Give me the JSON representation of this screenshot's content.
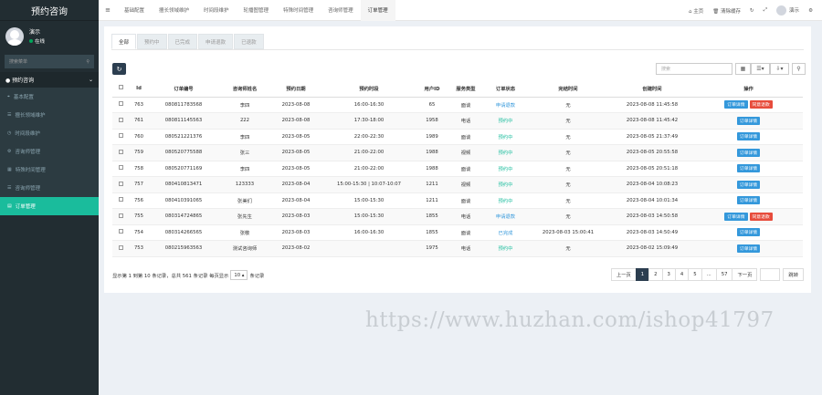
{
  "sidebar": {
    "brand": "预约咨询",
    "user_name": "演示",
    "user_status": "在线",
    "search_placeholder": "搜索菜单",
    "menu_header": "预约咨询",
    "items": [
      {
        "label": "基本配置",
        "icon": "location-icon"
      },
      {
        "label": "擅长领域维护",
        "icon": "list-icon"
      },
      {
        "label": "时间段维护",
        "icon": "clock-icon"
      },
      {
        "label": "咨询师管理",
        "icon": "gear-icon"
      },
      {
        "label": "特殊时间管理",
        "icon": "calendar-icon"
      },
      {
        "label": "咨询师管理",
        "icon": "list-icon"
      },
      {
        "label": "订单管理",
        "icon": "file-icon"
      }
    ]
  },
  "topbar": {
    "tabs": [
      "基础配置",
      "擅长领域维护",
      "时间段维护",
      "轮播图管理",
      "特殊时间管理",
      "咨询师管理",
      "订单管理"
    ],
    "home": "主页",
    "clear_cache": "清除缓存",
    "user": "演示"
  },
  "subtabs": [
    "全部",
    "预约中",
    "已完成",
    "申请退款",
    "已退款"
  ],
  "toolbar": {
    "search_placeholder": "搜索"
  },
  "table": {
    "headers": [
      "Id",
      "订单编号",
      "咨询师姓名",
      "预约日期",
      "预约时段",
      "用户ID",
      "服务类型",
      "订单状态",
      "完结时间",
      "创建时间",
      "操作"
    ],
    "rows": [
      {
        "id": "763",
        "order": "080811783568",
        "counselor": "李四",
        "date": "2023-08-08",
        "slot": "16:00-16:30",
        "uid": "65",
        "service": "面谈",
        "status": "申请退款",
        "status_class": "st-blue",
        "finish": "无",
        "created": "2023-08-08 11:45:58",
        "actions": [
          "订单详情",
          "同意退款"
        ]
      },
      {
        "id": "761",
        "order": "080811145563",
        "counselor": "222",
        "date": "2023-08-08",
        "slot": "17:30-18:00",
        "uid": "1958",
        "service": "电话",
        "status": "预约中",
        "status_class": "st-green",
        "finish": "无",
        "created": "2023-08-08 11:45:42",
        "actions": [
          "订单详情"
        ]
      },
      {
        "id": "760",
        "order": "080521221376",
        "counselor": "李四",
        "date": "2023-08-05",
        "slot": "22:00-22:30",
        "uid": "1989",
        "service": "面谈",
        "status": "预约中",
        "status_class": "st-green",
        "finish": "无",
        "created": "2023-08-05 21:37:49",
        "actions": [
          "订单详情"
        ]
      },
      {
        "id": "759",
        "order": "080520775588",
        "counselor": "张三",
        "date": "2023-08-05",
        "slot": "21:00-22:00",
        "uid": "1988",
        "service": "视频",
        "status": "预约中",
        "status_class": "st-green",
        "finish": "无",
        "created": "2023-08-05 20:55:58",
        "actions": [
          "订单详情"
        ]
      },
      {
        "id": "758",
        "order": "080520771169",
        "counselor": "李四",
        "date": "2023-08-05",
        "slot": "21:00-22:00",
        "uid": "1988",
        "service": "面谈",
        "status": "预约中",
        "status_class": "st-green",
        "finish": "无",
        "created": "2023-08-05 20:51:18",
        "actions": [
          "订单详情"
        ]
      },
      {
        "id": "757",
        "order": "080410813471",
        "counselor": "123333",
        "date": "2023-08-04",
        "slot": "15:00-15:30 | 10:07-10:07",
        "uid": "1211",
        "service": "视频",
        "status": "预约中",
        "status_class": "st-green",
        "finish": "无",
        "created": "2023-08-04 10:08:23",
        "actions": [
          "订单详情"
        ]
      },
      {
        "id": "756",
        "order": "080410391065",
        "counselor": "张美们",
        "date": "2023-08-04",
        "slot": "15:00-15:30",
        "uid": "1211",
        "service": "面谈",
        "status": "预约中",
        "status_class": "st-green",
        "finish": "无",
        "created": "2023-08-04 10:01:34",
        "actions": [
          "订单详情"
        ]
      },
      {
        "id": "755",
        "order": "080314724865",
        "counselor": "张先生",
        "date": "2023-08-03",
        "slot": "15:00-15:30",
        "uid": "1855",
        "service": "电话",
        "status": "申请退款",
        "status_class": "st-blue",
        "finish": "无",
        "created": "2023-08-03 14:50:58",
        "actions": [
          "订单详情",
          "同意退款"
        ]
      },
      {
        "id": "754",
        "order": "080314266565",
        "counselor": "张敬",
        "date": "2023-08-03",
        "slot": "16:00-16:30",
        "uid": "1855",
        "service": "面谈",
        "status": "已完成",
        "status_class": "st-blue",
        "finish": "2023-08-03 15:00:41",
        "created": "2023-08-03 14:50:49",
        "actions": [
          "订单详情"
        ]
      },
      {
        "id": "753",
        "order": "080215963563",
        "counselor": "测试咨询师",
        "date": "2023-08-02",
        "slot": "",
        "uid": "1975",
        "service": "电话",
        "status": "预约中",
        "status_class": "st-green",
        "finish": "无",
        "created": "2023-08-02 15:09:49",
        "actions": [
          "订单详情"
        ]
      }
    ]
  },
  "footer": {
    "info": "显示第 1 到第 10 条记录，总共 561 条记录 每页显示",
    "page_size": "10",
    "suffix": "条记录"
  },
  "pager": {
    "prev": "上一页",
    "pages": [
      "1",
      "2",
      "3",
      "4",
      "5",
      "...",
      "57"
    ],
    "next": "下一页",
    "jump": "跳转"
  },
  "watermark": "https://www.huzhan.com/ishop41797"
}
